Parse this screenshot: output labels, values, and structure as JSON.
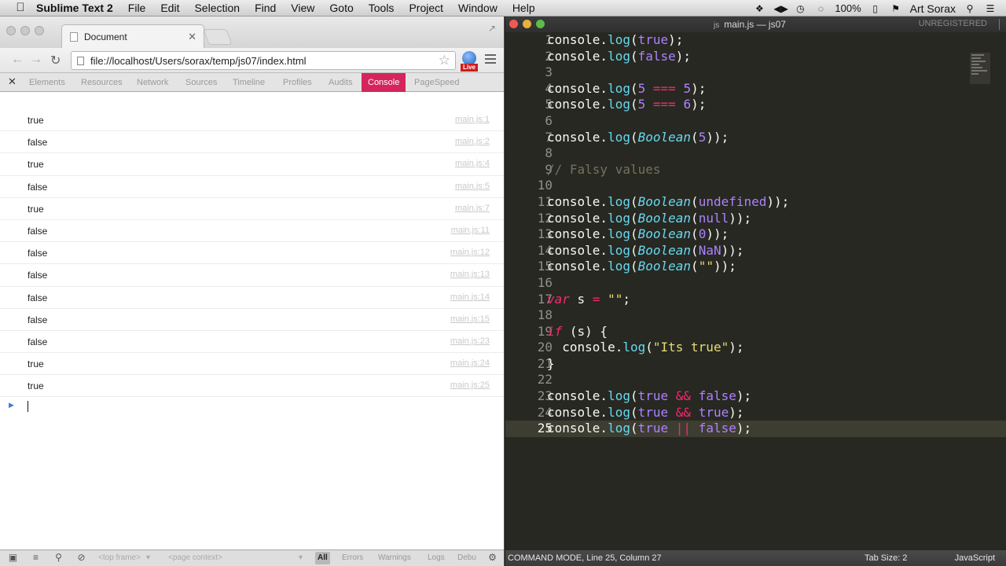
{
  "menubar": {
    "app_name": "Sublime Text 2",
    "items": [
      "File",
      "Edit",
      "Selection",
      "Find",
      "View",
      "Goto",
      "Tools",
      "Project",
      "Window",
      "Help"
    ],
    "battery": "100%",
    "user": "Art Sorax"
  },
  "browser": {
    "tab_title": "Document",
    "url": "file://localhost/Users/sorax/temp/js07/index.html",
    "live_badge": "Live",
    "devtools_tabs": [
      "Elements",
      "Resources",
      "Network",
      "Sources",
      "Timeline",
      "Profiles",
      "Audits",
      "Console",
      "PageSpeed"
    ],
    "active_devtools_tab": "Console",
    "console_rows": [
      {
        "value": "true",
        "source": "main.js:1"
      },
      {
        "value": "false",
        "source": "main.js:2"
      },
      {
        "value": "true",
        "source": "main.js:4"
      },
      {
        "value": "false",
        "source": "main.js:5"
      },
      {
        "value": "true",
        "source": "main.js:7"
      },
      {
        "value": "false",
        "source": "main.js:11"
      },
      {
        "value": "false",
        "source": "main.js:12"
      },
      {
        "value": "false",
        "source": "main.js:13"
      },
      {
        "value": "false",
        "source": "main.js:14"
      },
      {
        "value": "false",
        "source": "main.js:15"
      },
      {
        "value": "false",
        "source": "main.js:23"
      },
      {
        "value": "true",
        "source": "main.js:24"
      },
      {
        "value": "true",
        "source": "main.js:25"
      }
    ],
    "status": {
      "frame_select": "<top frame>",
      "context_select": "<page context>",
      "filters": [
        "All",
        "Errors",
        "Warnings",
        "Logs",
        "Debu"
      ],
      "active_filter": "All"
    }
  },
  "editor": {
    "title_icon": "js",
    "title": "main.js — js07",
    "unregistered": "UNREGISTERED",
    "current_line": 25,
    "lines": [
      {
        "n": "1",
        "text": "console.log(true);"
      },
      {
        "n": "2",
        "text": "console.log(false);"
      },
      {
        "n": "3",
        "text": ""
      },
      {
        "n": "4",
        "text": "console.log(5 === 5);"
      },
      {
        "n": "5",
        "text": "console.log(5 === 6);"
      },
      {
        "n": "6",
        "text": ""
      },
      {
        "n": "7",
        "text": "console.log(Boolean(5));"
      },
      {
        "n": "8",
        "text": ""
      },
      {
        "n": "9",
        "text": "// Falsy values"
      },
      {
        "n": "10",
        "text": ""
      },
      {
        "n": "11",
        "text": "console.log(Boolean(undefined));"
      },
      {
        "n": "12",
        "text": "console.log(Boolean(null));"
      },
      {
        "n": "13",
        "text": "console.log(Boolean(0));"
      },
      {
        "n": "14",
        "text": "console.log(Boolean(NaN));"
      },
      {
        "n": "15",
        "text": "console.log(Boolean(\"\"));"
      },
      {
        "n": "16",
        "text": ""
      },
      {
        "n": "17",
        "text": "var s = \"\";"
      },
      {
        "n": "18",
        "text": ""
      },
      {
        "n": "19",
        "text": "if (s) {"
      },
      {
        "n": "20",
        "text": "  console.log(\"Its true\");"
      },
      {
        "n": "21",
        "text": "}"
      },
      {
        "n": "22",
        "text": ""
      },
      {
        "n": "23",
        "text": "console.log(true && false);"
      },
      {
        "n": "24",
        "text": "console.log(true && true);"
      },
      {
        "n": "25",
        "text": "console.log(true || false);"
      }
    ],
    "status": {
      "mode": "COMMAND MODE, Line 25, Column 27",
      "tab_size": "Tab Size: 2",
      "syntax": "JavaScript"
    }
  },
  "colors": {
    "devtools_active": "#d5255d",
    "editor_bg": "#272822",
    "keyword": "#f92672",
    "constant": "#ae81ff",
    "type": "#66d9ef",
    "string": "#e6db74",
    "comment": "#75715e"
  }
}
